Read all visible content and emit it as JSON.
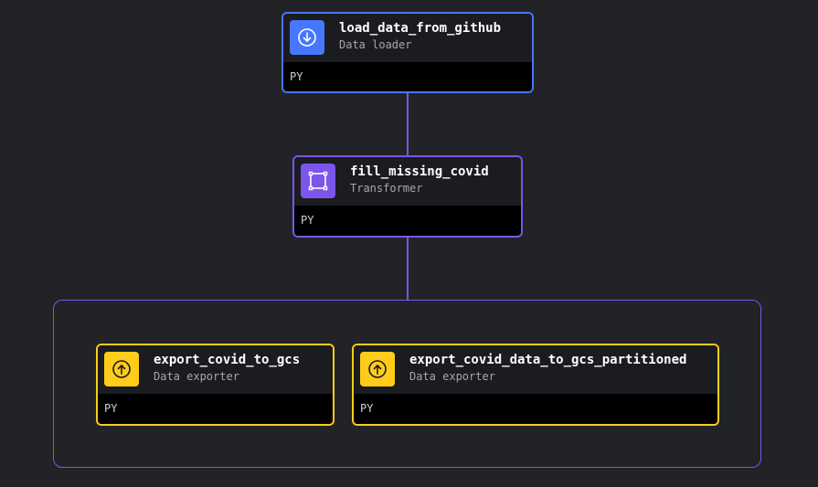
{
  "blocks": {
    "loader": {
      "name": "load_data_from_github",
      "type": "Data loader",
      "language": "PY",
      "color": "#4877ff",
      "icon": "download-icon"
    },
    "transformer": {
      "name": "fill_missing_covid",
      "type": "Transformer",
      "language": "PY",
      "color": "#7d55ec",
      "icon": "transform-square-icon"
    },
    "exporter1": {
      "name": "export_covid_to_gcs",
      "type": "Data exporter",
      "language": "PY",
      "color": "#ffcc19",
      "icon": "upload-icon"
    },
    "exporter2": {
      "name": "export_covid_data_to_gcs_partitioned",
      "type": "Data exporter",
      "language": "PY",
      "color": "#ffcc19",
      "icon": "upload-icon"
    }
  },
  "colors": {
    "background": "#222327",
    "edge": "#7d55ec"
  }
}
